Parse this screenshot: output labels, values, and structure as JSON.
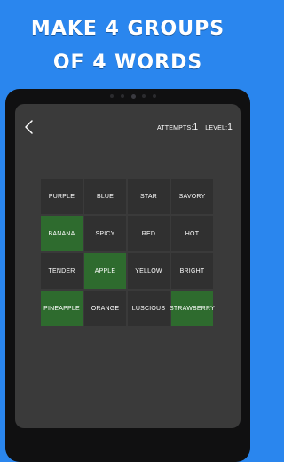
{
  "headline": {
    "line1": "MAKE 4 GROUPS",
    "line2": "OF 4 WORDS"
  },
  "header": {
    "attempts_label": "ATTEMPTS:",
    "attempts_value": "1",
    "level_label": "LEVEL:",
    "level_value": "1"
  },
  "colors": {
    "background": "#2a86ee",
    "screen": "#3a3a3a",
    "tile": "#303030",
    "tile_selected": "#2e6b2e"
  },
  "icons": {
    "back": "chevron-left-icon"
  },
  "board": {
    "tiles": [
      {
        "word": "PURPLE",
        "selected": false
      },
      {
        "word": "BLUE",
        "selected": false
      },
      {
        "word": "STAR",
        "selected": false
      },
      {
        "word": "SAVORY",
        "selected": false
      },
      {
        "word": "BANANA",
        "selected": true
      },
      {
        "word": "SPICY",
        "selected": false
      },
      {
        "word": "RED",
        "selected": false
      },
      {
        "word": "HOT",
        "selected": false
      },
      {
        "word": "TENDER",
        "selected": false
      },
      {
        "word": "APPLE",
        "selected": true
      },
      {
        "word": "YELLOW",
        "selected": false
      },
      {
        "word": "BRIGHT",
        "selected": false
      },
      {
        "word": "PINEAPPLE",
        "selected": true
      },
      {
        "word": "ORANGE",
        "selected": false
      },
      {
        "word": "LUSCIOUS",
        "selected": false
      },
      {
        "word": "STRAWBERRY",
        "selected": true
      }
    ]
  }
}
